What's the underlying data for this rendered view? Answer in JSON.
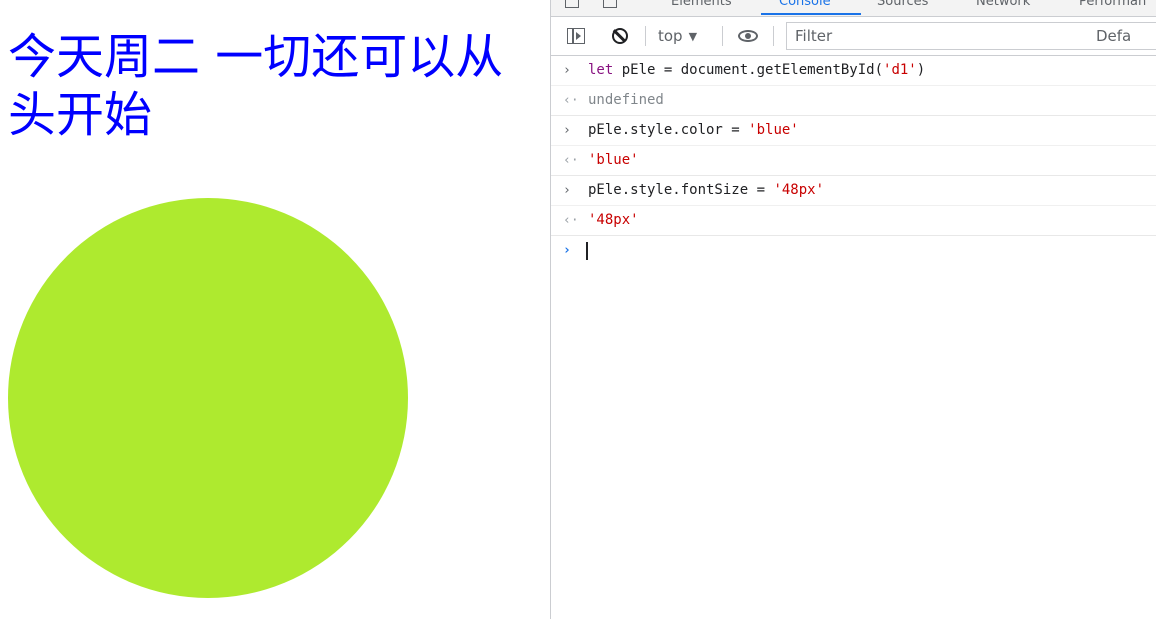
{
  "page": {
    "heading": "今天周二 一切还可以从头开始",
    "text_color": "#0000ff",
    "circle_color": "#aeea2f"
  },
  "devtools": {
    "tabs": [
      {
        "label": "Elements",
        "active": false
      },
      {
        "label": "Console",
        "active": true
      },
      {
        "label": "Sources",
        "active": false
      },
      {
        "label": "Network",
        "active": false
      },
      {
        "label": "Performan",
        "active": false
      }
    ],
    "toolbar": {
      "context": "top",
      "filter_placeholder": "Filter",
      "levels": "Defa"
    },
    "console": {
      "lines": [
        {
          "type": "input",
          "parts": [
            {
              "t": "let",
              "c": "kw"
            },
            {
              "t": " pEle = document.getElementById(",
              "c": ""
            },
            {
              "t": "'d1'",
              "c": "str"
            },
            {
              "t": ")",
              "c": ""
            }
          ]
        },
        {
          "type": "output",
          "parts": [
            {
              "t": "undefined",
              "c": "undef"
            }
          ]
        },
        {
          "type": "input",
          "parts": [
            {
              "t": "pEle.style.color = ",
              "c": ""
            },
            {
              "t": "'blue'",
              "c": "str"
            }
          ]
        },
        {
          "type": "output",
          "parts": [
            {
              "t": "'blue'",
              "c": "str"
            }
          ]
        },
        {
          "type": "input",
          "parts": [
            {
              "t": "pEle.style.fontSize = ",
              "c": ""
            },
            {
              "t": "'48px'",
              "c": "str"
            }
          ]
        },
        {
          "type": "output",
          "parts": [
            {
              "t": "'48px'",
              "c": "str"
            }
          ]
        }
      ]
    }
  }
}
